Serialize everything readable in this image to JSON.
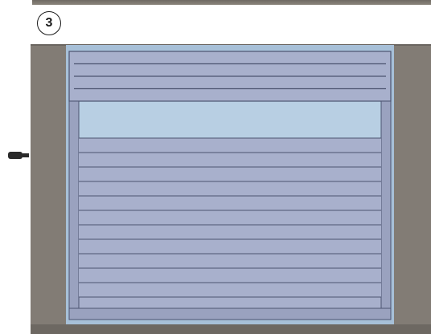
{
  "step": {
    "number": "3"
  },
  "colors": {
    "wall": "#827c75",
    "wall_dark": "#6d6862",
    "glass": "#a7c0d8",
    "glass_light": "#b8cfe3",
    "shutter": "#a8b0cc",
    "slat_line": "#4c5470",
    "frame": "#9aa2bf",
    "handle": "#2a2a2a"
  },
  "shutter": {
    "slat_count": 11,
    "upper_slat_count": 3
  }
}
